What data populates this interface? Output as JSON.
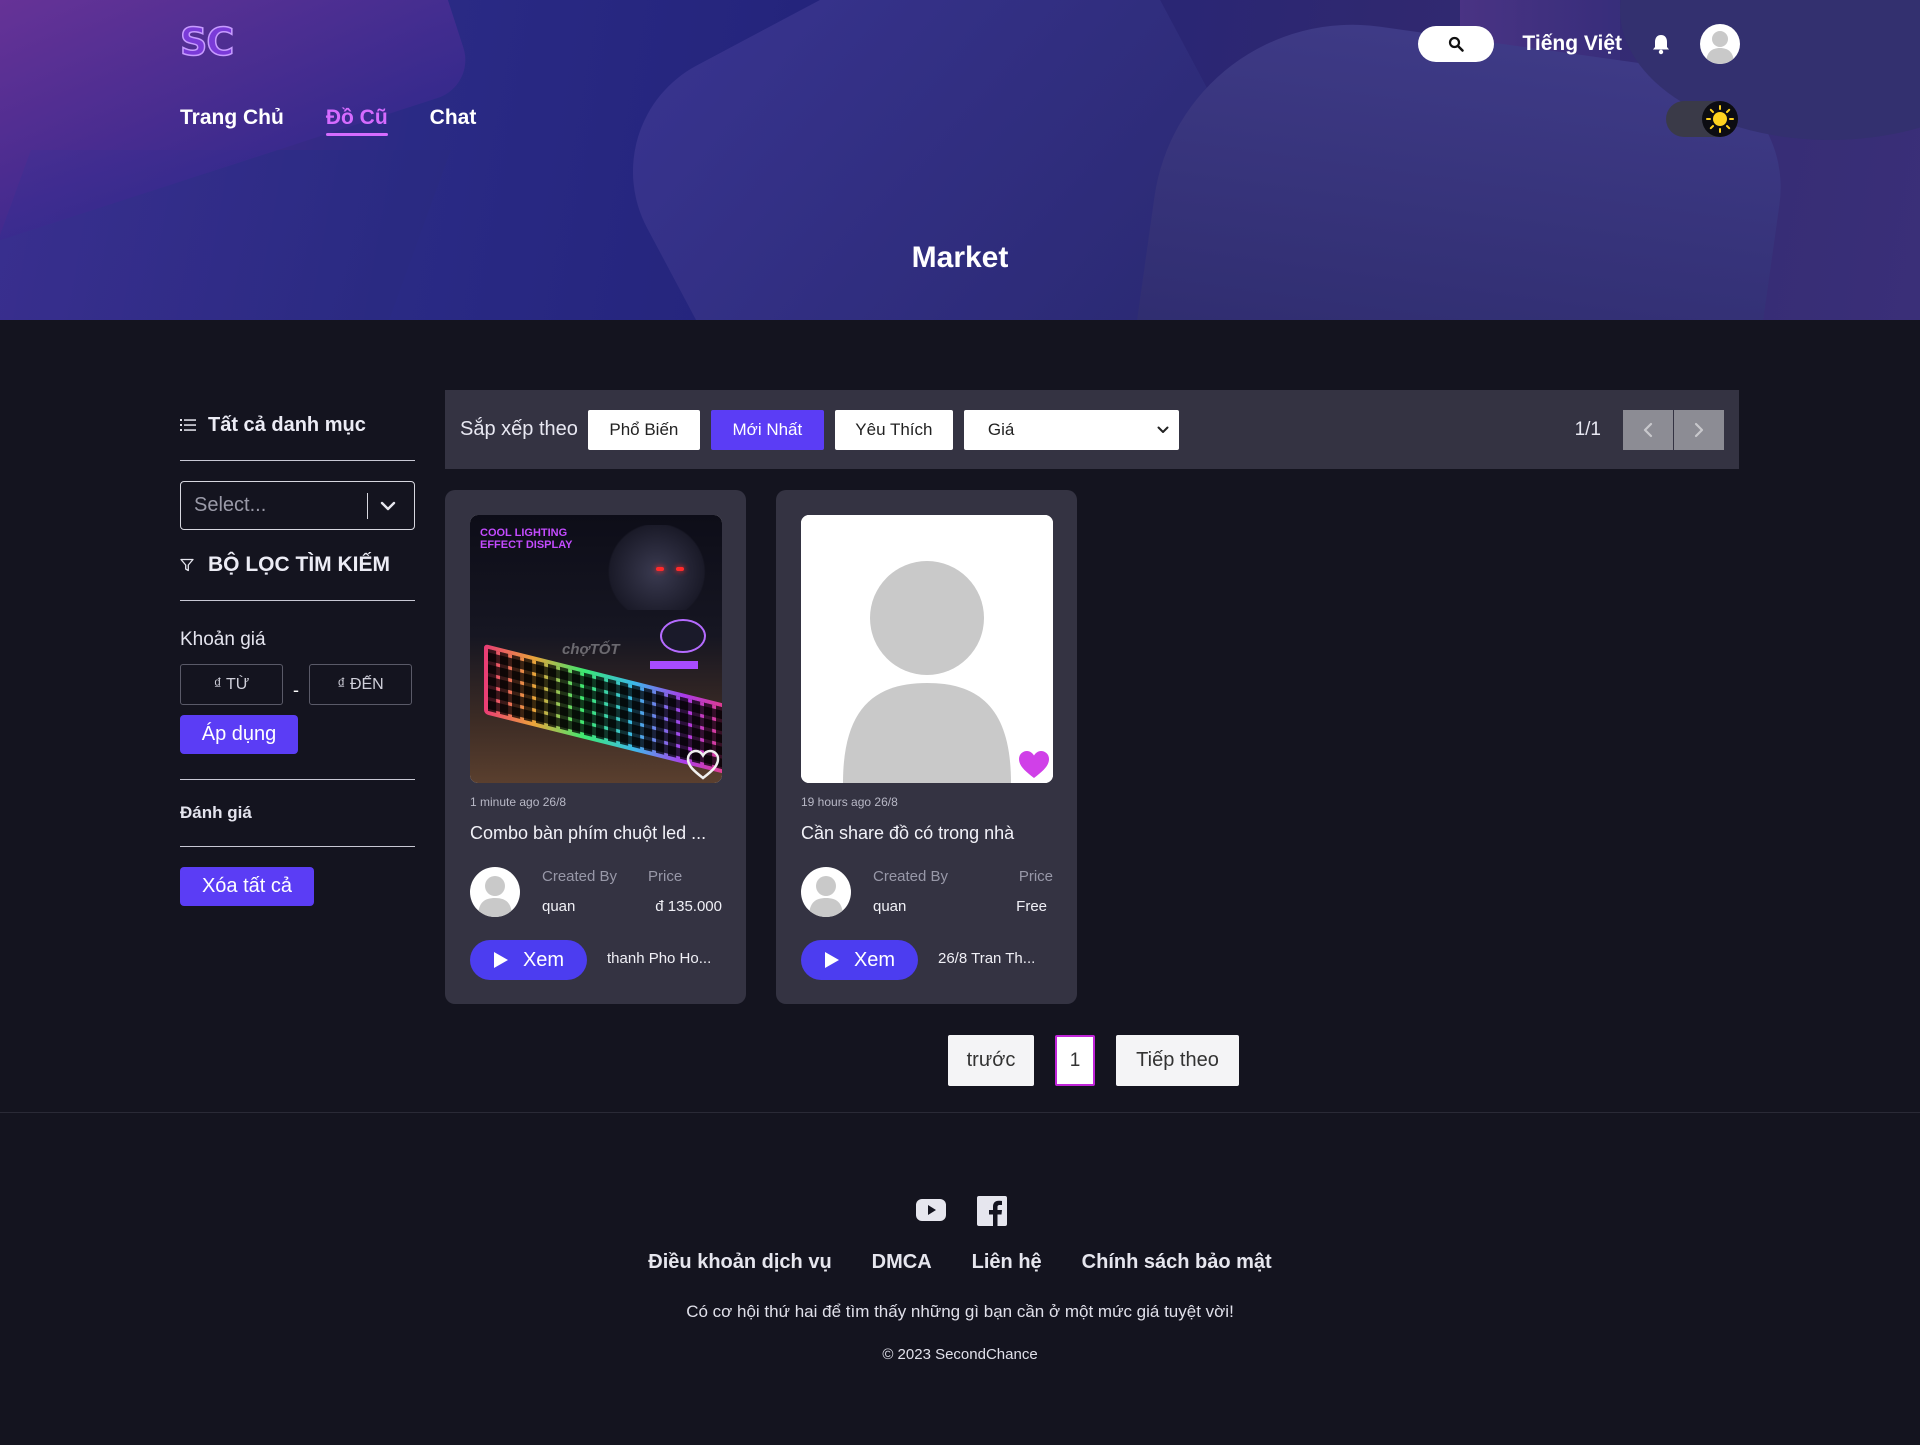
{
  "header": {
    "logo": "SC",
    "language": "Tiếng Việt",
    "nav": [
      {
        "label": "Trang Chủ"
      },
      {
        "label": "Đồ Cũ"
      },
      {
        "label": "Chat"
      }
    ],
    "active_nav": "Đồ Cũ"
  },
  "hero": {
    "title": "Market"
  },
  "sidebar": {
    "category_heading": "Tất cả danh mục",
    "select_placeholder": "Select...",
    "filter_heading": "Bộ lọc tìm kiếm",
    "price_label": "Khoản giá",
    "price_from_placeholder": "₫ TỪ",
    "price_to_placeholder": "₫ ĐẾN",
    "price_separator": "-",
    "apply_label": "Áp dụng",
    "rating_label": "Đánh giá",
    "clear_label": "Xóa tất cả"
  },
  "sortbar": {
    "label": "Sắp xếp theo",
    "options": [
      "Phổ Biến",
      "Mới Nhất",
      "Yêu Thích"
    ],
    "active": "Mới Nhất",
    "price_select": "Giá",
    "page_count": "1/1"
  },
  "products": [
    {
      "time": "1 minute ago 26/8",
      "title": "Combo bàn phím chuột led ...",
      "created_by_label": "Created By",
      "created_by": "quan",
      "price_label": "Price",
      "price": "đ 135.000",
      "watch_label": "Xem",
      "location": "thanh Pho Ho...",
      "image": "keyboard-photo",
      "image_text": {
        "headline": "COOL LIGHTING EFFECT DISPLAY",
        "watermark": "chợTỐT"
      },
      "favorited": false
    },
    {
      "time": "19 hours ago 26/8",
      "title": "Cần share đồ có trong nhà",
      "created_by_label": "Created By",
      "created_by": "quan",
      "price_label": "Price",
      "price": "Free",
      "watch_label": "Xem",
      "location": "26/8 Tran Th...",
      "image": "default-avatar",
      "favorited": true
    }
  ],
  "pagination": {
    "prev": "trước",
    "current": "1",
    "next": "Tiếp theo"
  },
  "footer": {
    "links": [
      "Điều khoản dịch vụ",
      "DMCA",
      "Liên hệ",
      "Chính sách bảo mật"
    ],
    "tagline": "Có cơ hội thứ hai để tìm thấy những gì bạn cần ở một mức giá tuyệt vời!",
    "copyright": "© 2023 SecondChance",
    "social": [
      "youtube-icon",
      "facebook-icon"
    ]
  },
  "colors": {
    "accent": "#5b3df5",
    "active_nav": "#d66bff",
    "heart": "#d040e8",
    "background": "#14141f",
    "card": "#343342"
  }
}
